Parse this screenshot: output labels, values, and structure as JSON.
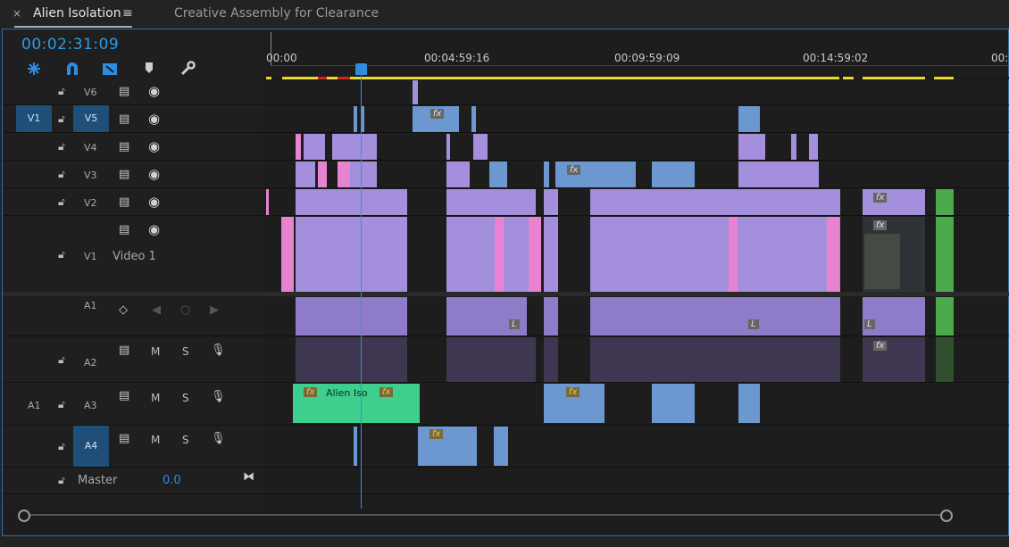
{
  "tabs": {
    "close_glyph": "×",
    "active": "Alien Isolation",
    "menu_glyph": "≡",
    "inactive": "Creative Assembly for Clearance"
  },
  "timecode": "00:02:31:09",
  "ruler": {
    "labels": [
      "00:00",
      "00:04:59:16",
      "00:09:59:09",
      "00:14:59:02",
      "00:"
    ]
  },
  "tracks": {
    "v6": "V6",
    "v5": "V5",
    "v4": "V4",
    "v3": "V3",
    "v2": "V2",
    "v1": "V1",
    "v1_source": "V1",
    "video1_name": "Video 1",
    "a1": "A1",
    "a2": "A2",
    "a3": "A3",
    "a4": "A4",
    "a1_source": "A1",
    "master": "Master",
    "master_value": "0.0",
    "m": "M",
    "s": "S"
  },
  "clips": {
    "fx": "fx",
    "alien_clip": "Alien Iso",
    "label_l": "L"
  },
  "colors": {
    "accent_blue": "#2e8ddf",
    "video_clip": "#a48fdc",
    "pink_clip": "#e783d1",
    "blue_clip": "#6c98cf",
    "green_clip": "#4ca94c",
    "audio_green": "#3ecf8e"
  },
  "icons": [
    "snap-icon",
    "linked-selection-icon",
    "add-marker-icon",
    "settings-wrench-icon",
    "lock-icon",
    "eye-icon",
    "film-icon",
    "mic-icon",
    "keyframe-icon"
  ]
}
